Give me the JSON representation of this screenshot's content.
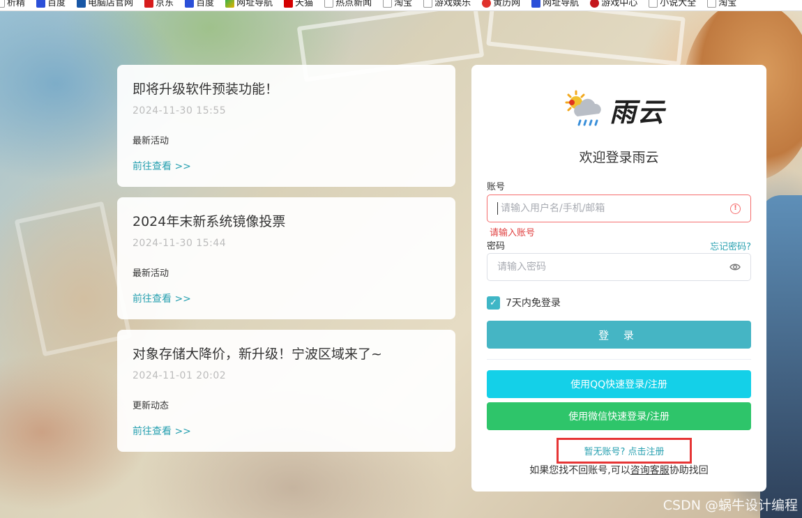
{
  "bookmarks": [
    {
      "label": "析精",
      "icon": "page-icon"
    },
    {
      "label": "百度",
      "icon": "baidu-icon"
    },
    {
      "label": "电脑店官网",
      "icon": "pc-icon"
    },
    {
      "label": "京东",
      "icon": "jd-icon"
    },
    {
      "label": "百度",
      "icon": "baidu-icon"
    },
    {
      "label": "网址导航",
      "icon": "nav-icon"
    },
    {
      "label": "天猫",
      "icon": "tmall-icon"
    },
    {
      "label": "热点新闻",
      "icon": "page-icon"
    },
    {
      "label": "淘宝",
      "icon": "page-icon"
    },
    {
      "label": "游戏娱乐",
      "icon": "page-icon"
    },
    {
      "label": "黄历网",
      "icon": "jin-icon"
    },
    {
      "label": "网址导航",
      "icon": "baidu-icon"
    },
    {
      "label": "游戏中心",
      "icon": "game-icon"
    },
    {
      "label": "小说大全",
      "icon": "page-icon"
    },
    {
      "label": "淘宝",
      "icon": "page-icon"
    }
  ],
  "news": [
    {
      "title": "即将升级软件预装功能！",
      "date": "2024-11-30 15:55",
      "category": "最新活动",
      "more": "前往查看 >>"
    },
    {
      "title": "2024年末新系统镜像投票",
      "date": "2024-11-30 15:44",
      "category": "最新活动",
      "more": "前往查看 >>"
    },
    {
      "title": "对象存储大降价，新升级！宁波区域来了~",
      "date": "2024-11-01 20:02",
      "category": "更新动态",
      "more": "前往查看 >>"
    }
  ],
  "login": {
    "brand": "雨云",
    "welcome": "欢迎登录雨云",
    "account_label": "账号",
    "account_placeholder": "请输入用户名/手机/邮箱",
    "account_error": "请输入账号",
    "password_label": "密码",
    "forgot": "忘记密码?",
    "password_placeholder": "请输入密码",
    "remember": "7天内免登录",
    "submit": "登 录",
    "qq": "使用QQ快速登录/注册",
    "wechat": "使用微信快速登录/注册",
    "register": "暂无账号? 点击注册",
    "recover_prefix": "如果您找不回账号,可以",
    "recover_link": "咨询客服",
    "recover_suffix": "协助找回"
  },
  "colors": {
    "accent": "#27a0b0",
    "login_button": "#45b5c4",
    "qq_button": "#14d0e8",
    "wechat_button": "#2ec56a",
    "error": "#f56c6c",
    "highlight_box": "#e63535"
  },
  "watermark": "CSDN @蜗牛设计编程"
}
